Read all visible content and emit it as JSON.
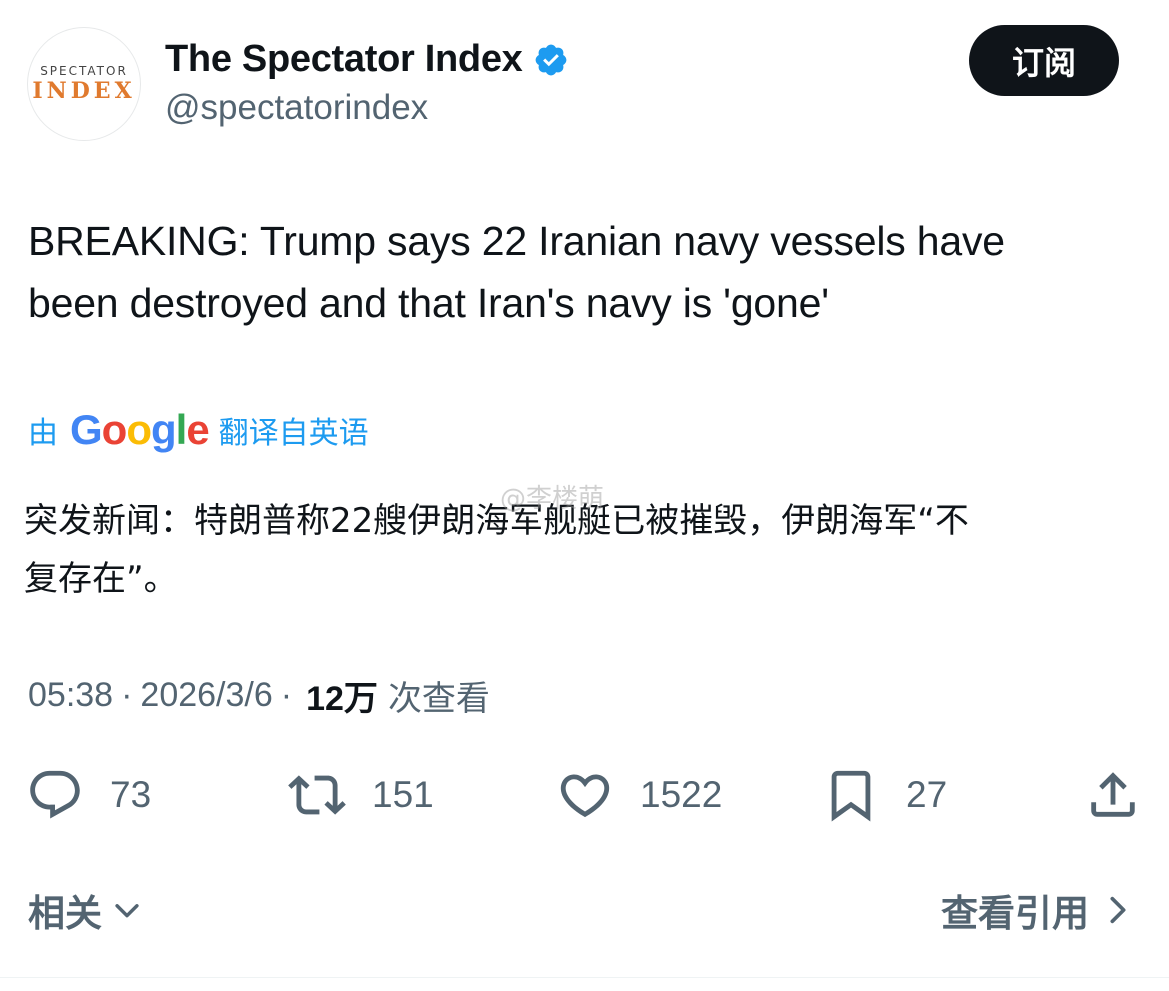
{
  "author": {
    "avatar_line1": "SPECTATOR",
    "avatar_line2": "INDEX",
    "display_name": "The Spectator Index",
    "handle": "@spectatorindex",
    "verified_icon": "verified-badge-icon"
  },
  "subscribe_label": "订阅",
  "tweet": {
    "text_line1": "BREAKING: Trump says 22 Iranian navy vessels have",
    "text_line2": "been destroyed and that Iran's navy is 'gone'"
  },
  "translation": {
    "by": "由",
    "google_g1": "G",
    "google_o1": "o",
    "google_o2": "o",
    "google_g2": "g",
    "google_l": "l",
    "google_e": "e",
    "from": "翻译自英语",
    "text_line1": "突发新闻：特朗普称22艘伊朗海军舰艇已被摧毁，伊朗海军“不",
    "text_line2": "复存在”。"
  },
  "watermark": "@李楼萌",
  "meta": {
    "time": "05:38",
    "sep": "·",
    "date": "2026/3/6",
    "views": "12万",
    "views_label": "次查看"
  },
  "actions": {
    "reply": {
      "icon": "reply-icon",
      "count": "73"
    },
    "retweet": {
      "icon": "retweet-icon",
      "count": "151"
    },
    "like": {
      "icon": "heart-icon",
      "count": "1522"
    },
    "bookmark": {
      "icon": "bookmark-icon",
      "count": "27"
    },
    "share": {
      "icon": "share-icon"
    }
  },
  "footer": {
    "related_label": "相关",
    "quotes_label": "查看引用"
  },
  "colors": {
    "link": "#1d9bf0",
    "secondary": "#536471",
    "primary": "#0f1419",
    "brand_orange": "#e07a2e"
  }
}
